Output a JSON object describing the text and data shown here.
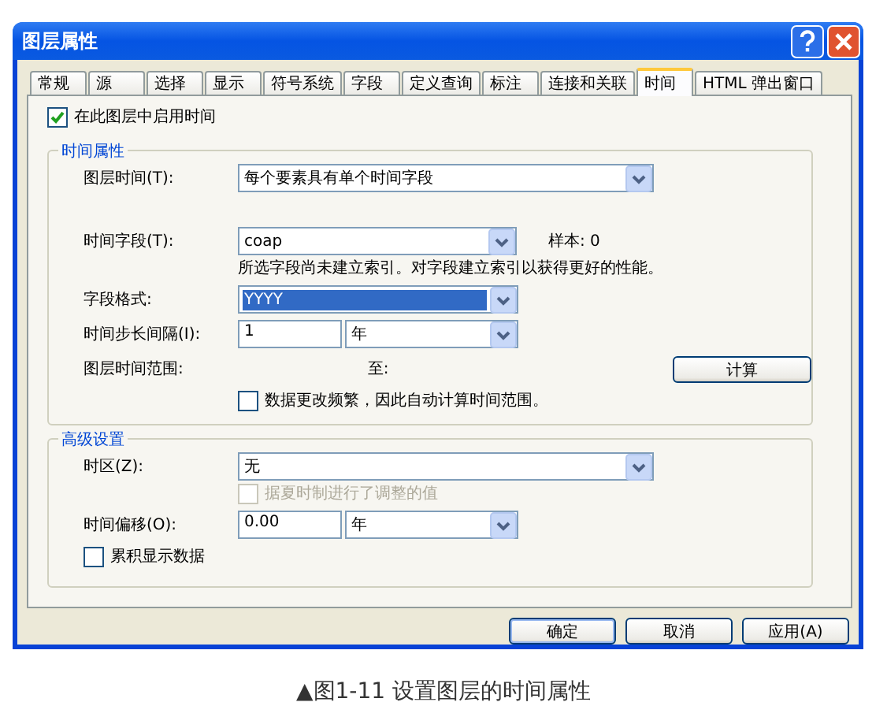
{
  "window": {
    "title": "图层属性"
  },
  "tabs": [
    {
      "label": "常规",
      "selected": false
    },
    {
      "label": "源",
      "selected": false
    },
    {
      "label": "选择",
      "selected": false
    },
    {
      "label": "显示",
      "selected": false
    },
    {
      "label": "符号系统",
      "selected": false
    },
    {
      "label": "字段",
      "selected": false
    },
    {
      "label": "定义查询",
      "selected": false
    },
    {
      "label": "标注",
      "selected": false
    },
    {
      "label": "连接和关联",
      "selected": false
    },
    {
      "label": "时间",
      "selected": true
    },
    {
      "label": "HTML 弹出窗口",
      "selected": false
    }
  ],
  "enable_time": {
    "label": "在此图层中启用时间",
    "checked": true
  },
  "time_properties": {
    "legend": "时间属性",
    "layer_time": {
      "label": "图层时间(T):",
      "value": "每个要素具有单个时间字段"
    },
    "time_field": {
      "label": "时间字段(T):",
      "value": "coap"
    },
    "sample": "样本: 0",
    "index_note": "所选字段尚未建立索引。对字段建立索引以获得更好的性能。",
    "field_format": {
      "label": "字段格式:",
      "value": "YYYY",
      "selected": true
    },
    "step_interval": {
      "label": "时间步长间隔(I):",
      "value": "1",
      "unit": "年"
    },
    "time_extent": {
      "label": "图层时间范围:",
      "to_label": "至:",
      "button": "计算"
    },
    "auto_calc": {
      "label": "数据更改频繁，因此自动计算时间范围。",
      "checked": false
    }
  },
  "advanced": {
    "legend": "高级设置",
    "time_zone": {
      "label": "时区(Z):",
      "value": "无"
    },
    "dst": {
      "label": "据夏时制进行了调整的值",
      "checked": false,
      "disabled": true
    },
    "offset": {
      "label": "时间偏移(O):",
      "value": "0.00",
      "unit": "年"
    },
    "cumulative": {
      "label": "累积显示数据",
      "checked": false
    }
  },
  "buttons": [
    {
      "label": "确定"
    },
    {
      "label": "取消"
    },
    {
      "label": "应用(A)"
    }
  ],
  "caption": "▲图1-11 设置图层的时间属性"
}
